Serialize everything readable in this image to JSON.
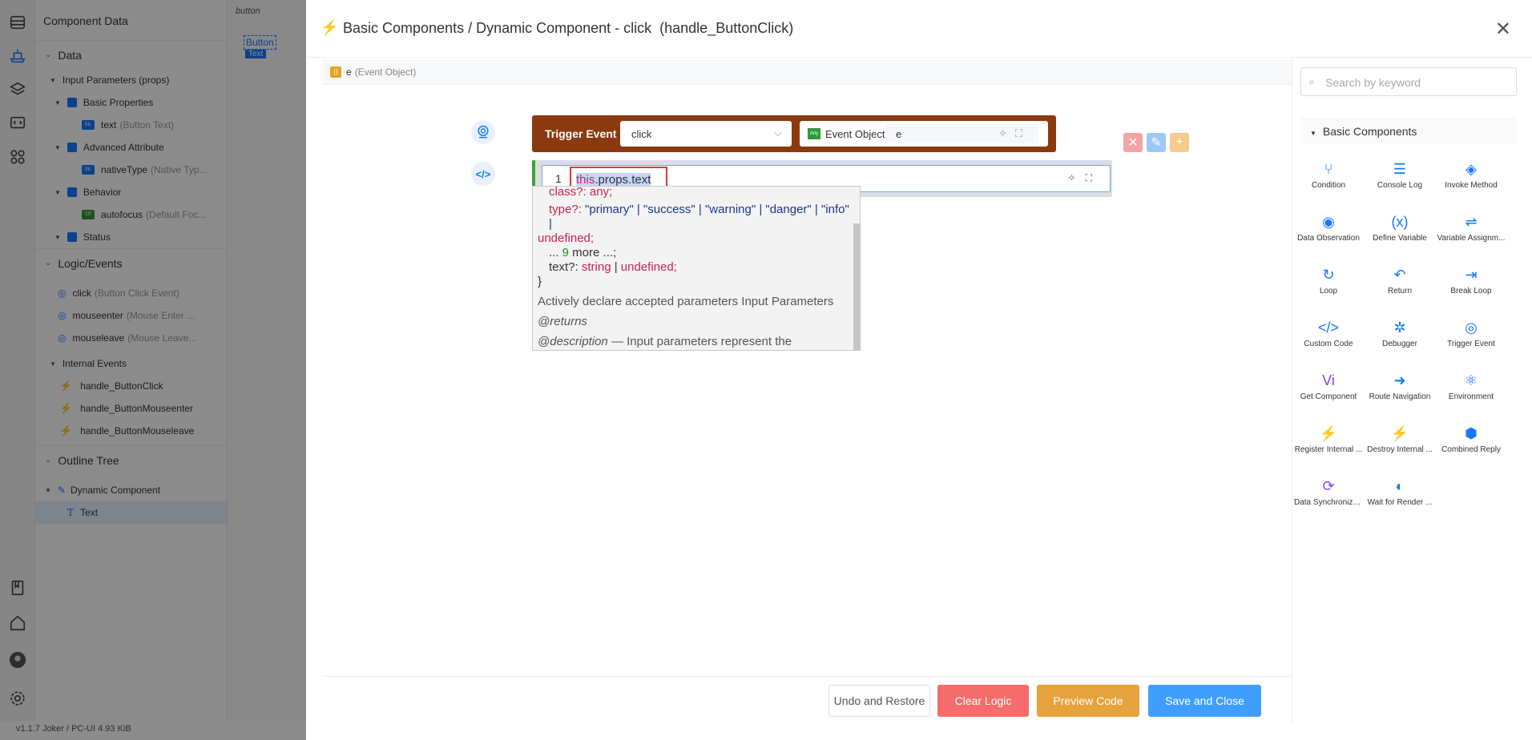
{
  "left_panel": {
    "title": "Component Data",
    "data_section": "Data",
    "props_group": "Input Parameters (props)",
    "basic_group": "Basic Properties",
    "text_item": "text",
    "text_hint": "(Button Text)",
    "adv_group": "Advanced Attribute",
    "native_item": "nativeType",
    "native_hint": "(Native Typ...",
    "behavior_group": "Behavior",
    "autofocus_item": "autofocus",
    "autofocus_hint": "(Default Foc...",
    "status_group": "Status",
    "logic_section": "Logic/Events",
    "events": [
      {
        "name": "click",
        "hint": "(Button Click Event)"
      },
      {
        "name": "mouseenter",
        "hint": "(Mouse Enter ..."
      },
      {
        "name": "mouseleave",
        "hint": "(Mouse Leave..."
      }
    ],
    "internal_group": "Internal Events",
    "handlers": [
      "handle_ButtonClick",
      "handle_ButtonMouseenter",
      "handle_ButtonMouseleave"
    ],
    "outline_section": "Outline Tree",
    "outline_root": "Dynamic Component",
    "outline_child": "Text",
    "badges": {
      "str": "Str.",
      "tf": "T/F"
    }
  },
  "canvas_bg": {
    "tab": "button",
    "el_button": "Button",
    "el_text": "Text"
  },
  "status_bar": "v1.1.7   Joker / PC-UI   4.93 KiB",
  "modal": {
    "title": "Basic Components / Dynamic Component - click  (handle_ButtonClick)",
    "param_name": "e",
    "param_hint": "(Event Object)",
    "trigger_label": "Trigger Event",
    "trigger_value": "click",
    "event_object_label": "Event Object",
    "any_badge": "Any",
    "event_object_value": "e",
    "line_no": "1",
    "code_this": "this",
    "code_rest": ".props.text",
    "popup": {
      "l1a": "class?: ",
      "l1b": "any;",
      "l2a": "type?: ",
      "l2b": "\"primary\" | \"success\" | \"warning\" | \"danger\" | \"info\" |",
      "l3": "undefined;",
      "l4a": "... ",
      "l4b": "9",
      "l4c": " more ...;",
      "l5a": "text?: ",
      "l5b": "string",
      "l5c": " | ",
      "l5d": "undefined;",
      "l6": "}",
      "p1": "Actively declare accepted parameters Input Parameters",
      "p2": "@returns",
      "p3a": "@description",
      "p3b": " — Input parameters represent the parameters received by the current component"
    },
    "footer": {
      "undo": "Undo and Restore",
      "clear": "Clear Logic",
      "preview": "Preview Code",
      "save": "Save and Close"
    },
    "search_placeholder": "Search by keyword",
    "tools_group": "Basic Components",
    "tools": [
      "Condition",
      "Console Log",
      "Invoke Method",
      "Data Observation",
      "Define Variable",
      "Variable Assignm...",
      "Loop",
      "Return",
      "Break Loop",
      "Custom Code",
      "Debugger",
      "Trigger Event",
      "Get Component",
      "Route Navigation",
      "Environment",
      "Register Internal ...",
      "Destroy Internal ...",
      "Combined Reply",
      "Data Synchroniza...",
      "Wait for Render ..."
    ]
  },
  "colors": {
    "primary": "#409eff",
    "danger": "#f56c6c",
    "warning": "#e6a23c",
    "trigger": "#8b3a0f",
    "accent": "#1677ff"
  }
}
